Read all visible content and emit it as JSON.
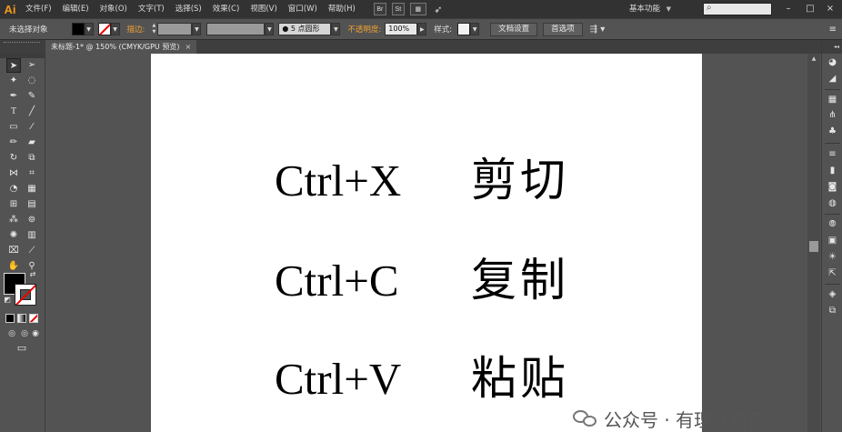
{
  "app": {
    "logo": "Ai",
    "workspace": "基本功能"
  },
  "menu": [
    "文件(F)",
    "编辑(E)",
    "对象(O)",
    "文字(T)",
    "选择(S)",
    "效果(C)",
    "视图(V)",
    "窗口(W)",
    "帮助(H)"
  ],
  "menu_buttons": [
    "Br",
    "St"
  ],
  "window_controls": {
    "minimize": "–",
    "restore": "□",
    "close": "×"
  },
  "control_bar": {
    "selection_status": "未选择对象",
    "stroke_label": "描边:",
    "brush_label": "5 点圆形",
    "opacity_label": "不透明度:",
    "opacity_value": "100%",
    "style_label": "样式:",
    "doc_setup_button": "文档设置",
    "prefs_button": "首选项"
  },
  "document_tab": {
    "title": "未标题-1* @ 150% (CMYK/GPU 预览)",
    "close": "×"
  },
  "artboard_lines": [
    {
      "shortcut": "Ctrl+X",
      "action": "剪切"
    },
    {
      "shortcut": "Ctrl+C",
      "action": "复制"
    },
    {
      "shortcut": "Ctrl+V",
      "action": "粘贴"
    }
  ],
  "watermark": {
    "text": "公众号 · 有理儿有面"
  },
  "colors": {
    "fill": "#000000",
    "stroke_none": "#e00000",
    "accent_orange": "#f29a1c",
    "artboard": "#ffffff",
    "workspace_bg": "#535353"
  }
}
